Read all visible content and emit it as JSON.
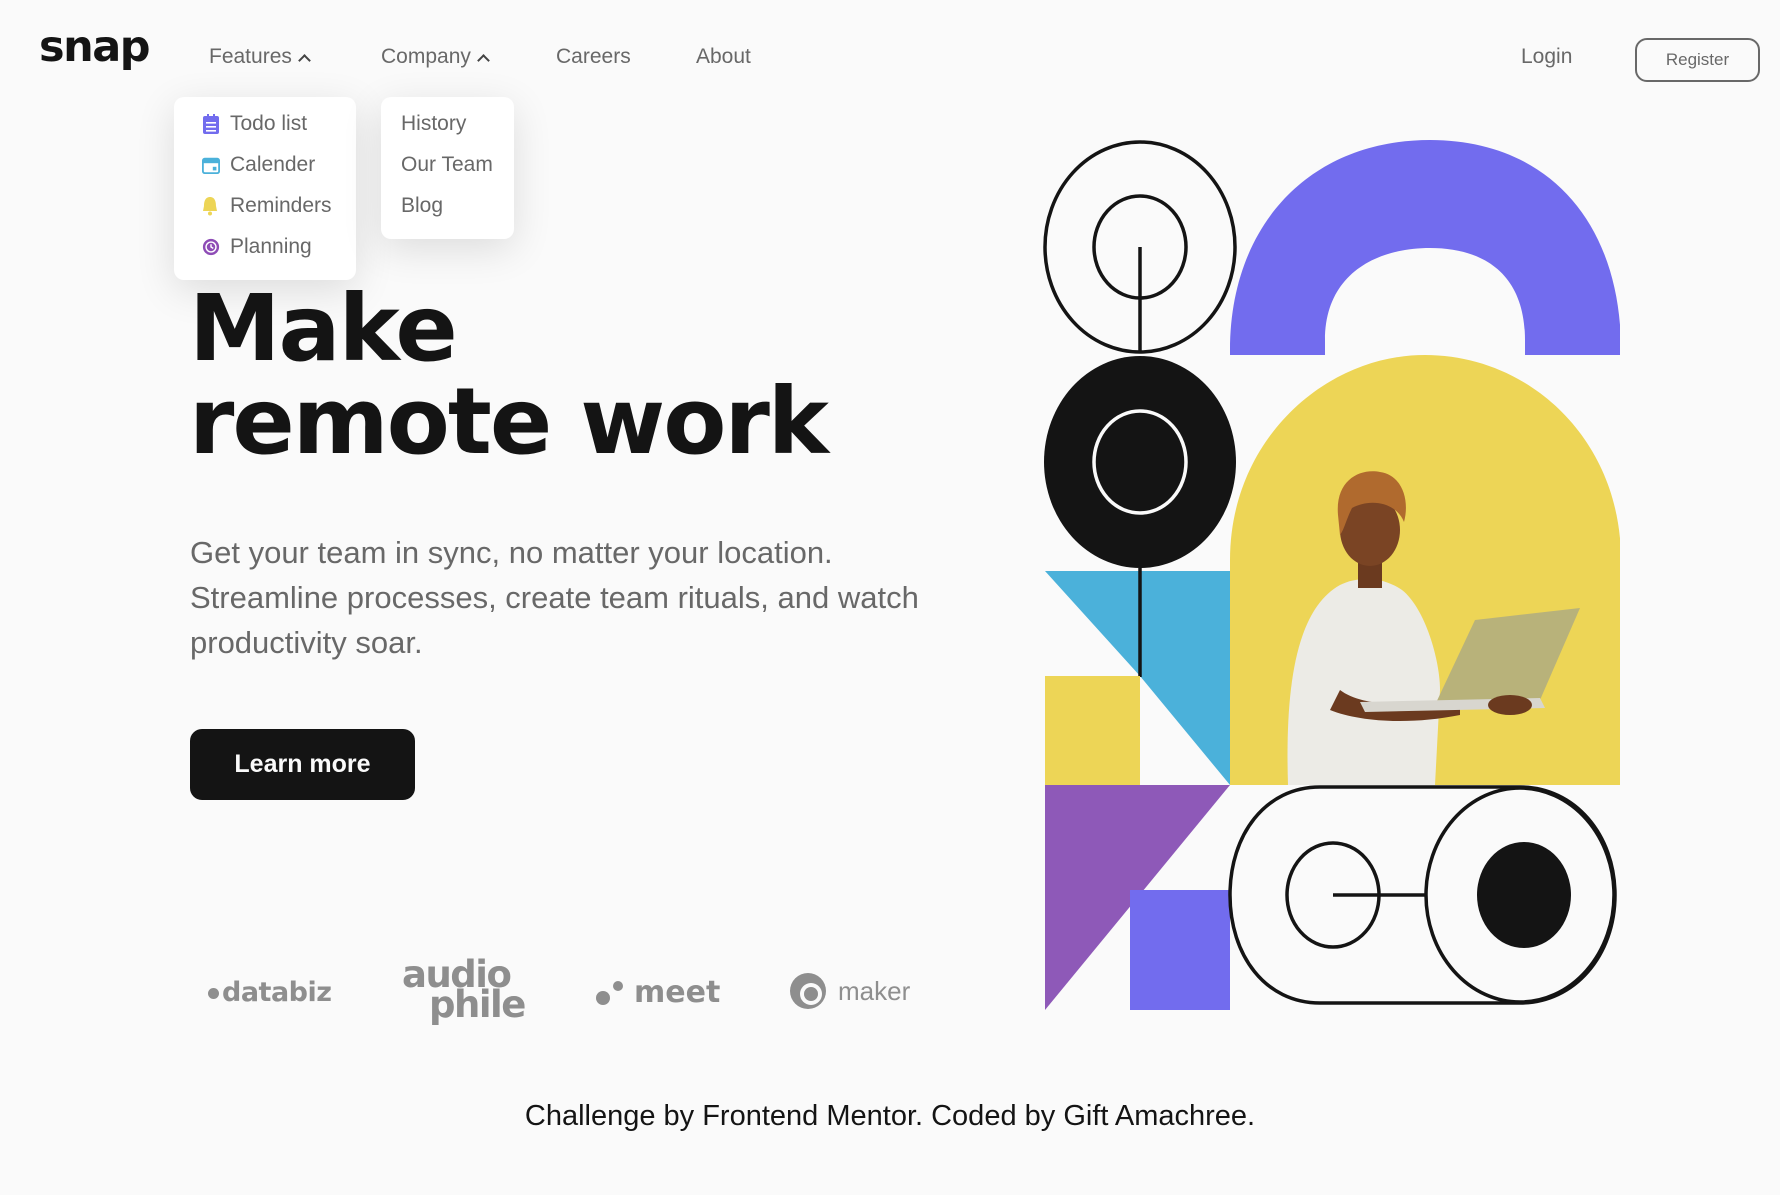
{
  "brand": {
    "logo": "snap"
  },
  "nav": {
    "features": {
      "label": "Features",
      "expanded": true
    },
    "company": {
      "label": "Company",
      "expanded": true
    },
    "careers": "Careers",
    "about": "About",
    "login": "Login",
    "register": "Register"
  },
  "features_menu": [
    {
      "label": "Todo list",
      "icon": "todo-list-icon",
      "color": "#726CEE"
    },
    {
      "label": "Calender",
      "icon": "calendar-icon",
      "color": "#4BB1DA"
    },
    {
      "label": "Reminders",
      "icon": "bell-icon",
      "color": "#EDD556"
    },
    {
      "label": "Planning",
      "icon": "clock-icon",
      "color": "#8E4CB6"
    }
  ],
  "company_menu": [
    {
      "label": "History"
    },
    {
      "label": "Our Team"
    },
    {
      "label": "Blog"
    }
  ],
  "hero": {
    "headline_line1": "Make",
    "headline_line2": "remote work",
    "subcopy": "Get your team in sync, no matter your location. Streamline processes, create team rituals, and watch productivity soar.",
    "cta": "Learn more"
  },
  "clients": {
    "databiz": "databiz",
    "audiophile_line1": "audio",
    "audiophile_line2": "phile",
    "meet": "meet",
    "maker": "maker"
  },
  "footer": {
    "attribution": "Challenge by Frontend Mentor. Coded by Gift Amachree."
  },
  "colors": {
    "background": "#FAFAFA",
    "text_dark": "#141414",
    "text_muted": "#686868",
    "illustration_purple": "#726CEE",
    "illustration_yellow": "#EDD556",
    "illustration_blue": "#4BB1DA",
    "illustration_violet": "#8E59B8"
  }
}
